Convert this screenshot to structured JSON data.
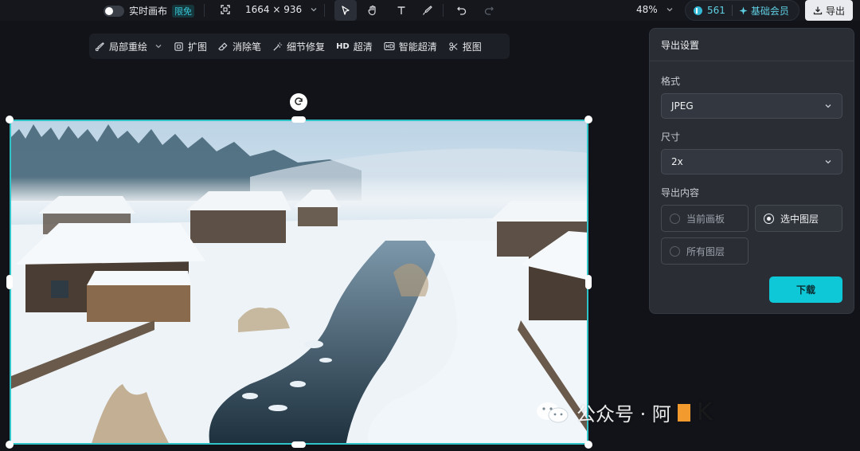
{
  "top_toolbar": {
    "realtime_canvas_label": "实时画布",
    "limited_badge": "限免",
    "canvas_size": "1664 × 936",
    "zoom": "48%",
    "credits": "561",
    "membership_label": "基础会员",
    "export_label": "导出"
  },
  "edit_toolbar": {
    "items": [
      {
        "label": "局部重绘",
        "icon": "brush-icon"
      },
      {
        "label": "扩图",
        "icon": "expand-icon"
      },
      {
        "label": "消除笔",
        "icon": "eraser-icon"
      },
      {
        "label": "细节修复",
        "icon": "magic-wand-icon"
      },
      {
        "label": "超清",
        "icon": "hd-icon",
        "prefix": "HD"
      },
      {
        "label": "智能超清",
        "icon": "smart-hd-icon"
      },
      {
        "label": "抠图",
        "icon": "cutout-icon"
      }
    ]
  },
  "export_panel": {
    "title": "导出设置",
    "format_label": "格式",
    "format_value": "JPEG",
    "size_label": "尺寸",
    "size_value": "2x",
    "content_label": "导出内容",
    "options": [
      {
        "label": "当前画板",
        "selected": false
      },
      {
        "label": "选中图层",
        "selected": true
      },
      {
        "label": "所有图层",
        "selected": false
      }
    ],
    "download_label": "下载"
  },
  "watermark": {
    "text": "公众号 · 阿",
    "brand_text": "K"
  },
  "colors": {
    "accent": "#0ec8d8",
    "selection_border": "#2fc3c8",
    "background": "#111318",
    "panel": "#2a2d34"
  }
}
